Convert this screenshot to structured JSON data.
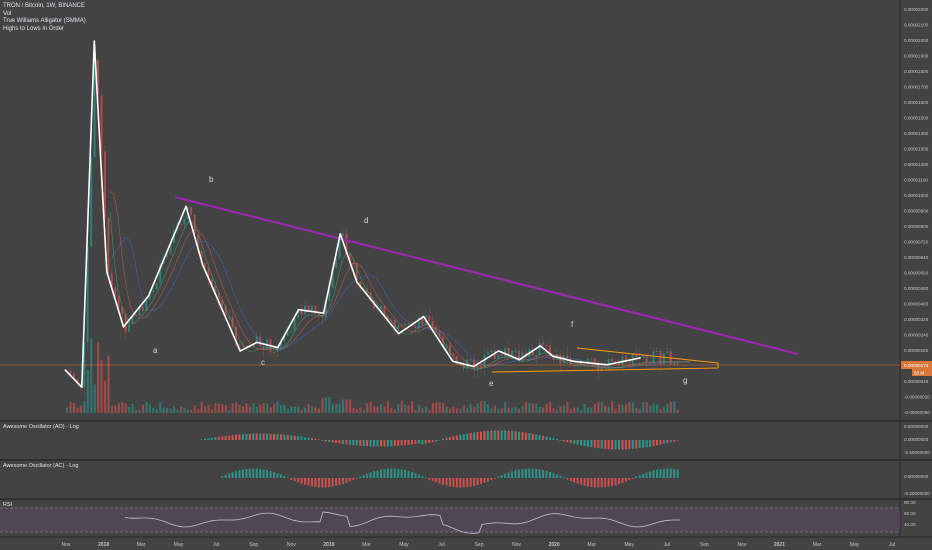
{
  "legend": {
    "symbol_line": "TRON / Bitcoin, 1W, BINANCE",
    "items": [
      "Vol",
      "True Williams Alligator (SMMA)",
      "Highs to Lows in Order"
    ]
  },
  "panes": {
    "ao_title": "Awesome Oscillator (AO) - Log",
    "ac_title": "Awesome Oscillator (AC) - Log",
    "rsi_title": "RSI"
  },
  "price_axis": {
    "ticks": [
      "0.00002200",
      "0.00002100",
      "0.00002000",
      "0.00001900",
      "0.00001800",
      "0.00001700",
      "0.00001600",
      "0.00001500",
      "0.00001400",
      "0.00001300",
      "0.00001200",
      "0.00001100",
      "0.00001000",
      "0.00000900",
      "0.00000800",
      "0.00000720",
      "0.00000640",
      "0.00000560",
      "0.00000480",
      "0.00000400",
      "0.00000320",
      "0.00000240",
      "0.00000160",
      "0.00000080",
      "0.00000040",
      "-0.00000020",
      "-0.00000080"
    ],
    "last_price": "0.00000174",
    "last_volume": "50 M"
  },
  "ao_axis": [
    "0.50000000",
    "0.00000000",
    "-0.50000000"
  ],
  "ac_axis": [
    "0.00000000",
    "-0.20000000"
  ],
  "rsi_axis": [
    "80.00",
    "60.00",
    "40.00"
  ],
  "time_axis": [
    "Nov",
    "2018",
    "Mar",
    "May",
    "Jul",
    "Sep",
    "Nov",
    "2019",
    "Mar",
    "May",
    "Jul",
    "Sep",
    "Nov",
    "2020",
    "Mar",
    "May",
    "Jul",
    "Sep",
    "Nov",
    "2021",
    "Mar",
    "May",
    "Jul"
  ],
  "wave_labels": [
    "a",
    "b",
    "c",
    "d",
    "e",
    "f",
    "g"
  ],
  "colors": {
    "background": "#434343",
    "up": "#26a69a",
    "down": "#ef5350",
    "wave": "#ffffff",
    "resistance": "#9c27b0",
    "triangle": "#ff9800",
    "rsi": "#c5bfd6"
  },
  "chart_data": {
    "type": "line",
    "title": "TRON / Bitcoin, 1W, BINANCE",
    "series": [
      {
        "name": "Highs to Lows in Order",
        "x": [
          "2017-10-30",
          "2017-11-27",
          "2017-12-18",
          "2018-01-08",
          "2018-02-05",
          "2018-03-19",
          "2018-05-21",
          "2018-06-18",
          "2018-08-20",
          "2018-09-17",
          "2018-10-22",
          "2018-11-26",
          "2019-01-07",
          "2019-02-04",
          "2019-03-04",
          "2019-05-13",
          "2019-06-24",
          "2019-08-12",
          "2019-09-16",
          "2019-10-28",
          "2019-12-02",
          "2020-01-06",
          "2020-01-27",
          "2020-03-02",
          "2020-04-27",
          "2020-05-25",
          "2020-06-22"
        ],
        "values": [
          1.5e-06,
          5e-07,
          2.06e-05,
          7.2e-06,
          4e-06,
          5.8e-06,
          1.1e-05,
          7.6e-06,
          2.6e-06,
          3.1e-06,
          2.8e-06,
          5e-06,
          4.8e-06,
          9.4e-06,
          6.6e-06,
          3.6e-06,
          4.6e-06,
          2e-06,
          1.7e-06,
          2.6e-06,
          2.1e-06,
          2.9e-06,
          2.3e-06,
          2e-06,
          1.8e-06,
          2e-06,
          2.2e-06
        ]
      }
    ],
    "annotations": [
      "a",
      "b",
      "c",
      "d",
      "e",
      "f",
      "g"
    ],
    "ylabel": "",
    "ylim": [
      -1e-06,
      2.24e-05
    ],
    "last_value": 1.74e-06,
    "grid": false
  }
}
